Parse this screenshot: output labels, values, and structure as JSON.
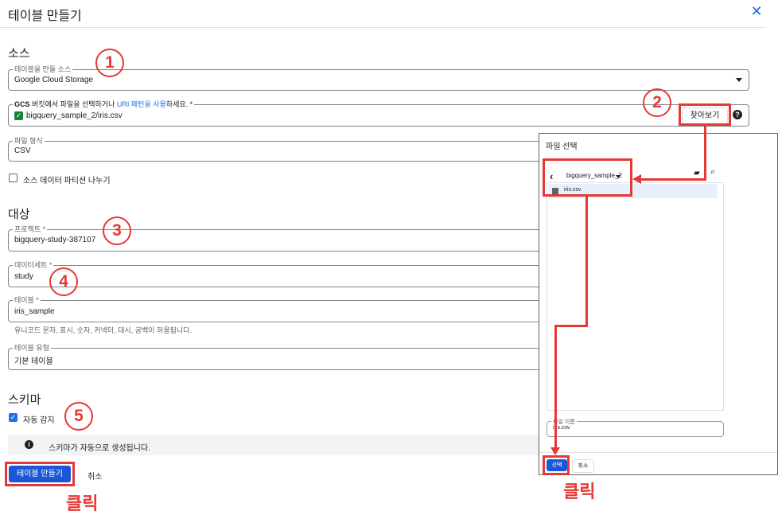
{
  "dialog": {
    "title": "테이블 만들기"
  },
  "source": {
    "heading": "소스",
    "create_from_label": "테이블을 만들 소스",
    "create_from_value": "Google Cloud Storage",
    "gcs_label_bold": "GCS",
    "gcs_label_text": " 버킷에서 파일을 선택하거나 ",
    "gcs_label_link": "URI 패턴을 사용",
    "gcs_label_end": "하세요. *",
    "gcs_path": "bigquery_sample_2/iris.csv",
    "browse_label": "찾아보기",
    "file_format_label": "파일 형식",
    "file_format_value": "CSV",
    "partition_label": "소스 데이터 파티션 나누기"
  },
  "destination": {
    "heading": "대상",
    "project_label": "프로젝트 *",
    "project_value": "bigquery-study-387107",
    "dataset_label": "데이터세트 *",
    "dataset_value": "study",
    "table_label": "테이블 *",
    "table_value": "iris_sample",
    "table_hint": "유니코드 문자, 표시, 숫자, 커넥터, 대시, 공백이 허용됩니다.",
    "table_type_label": "테이블 유형",
    "table_type_value": "기본 테이블"
  },
  "schema": {
    "heading": "스키마",
    "auto_detect_label": "자동 감지",
    "info_text": "스키마가 자동으로 생성됩니다."
  },
  "footer": {
    "create_label": "테이블 만들기",
    "cancel_label": "취소"
  },
  "file_picker": {
    "title": "파일 선택",
    "bucket": "bigquery_sample_2",
    "file_item": "iris.csv",
    "file_name_label": "파일 이름",
    "file_name_value": "iris.csv",
    "select_label": "선택",
    "cancel_label": "취소"
  },
  "annotations": {
    "step1": "1",
    "step2": "2",
    "step3": "3",
    "step4": "4",
    "step5": "5",
    "click_left": "클릭",
    "click_right": "클릭",
    "color": "#e53935"
  }
}
